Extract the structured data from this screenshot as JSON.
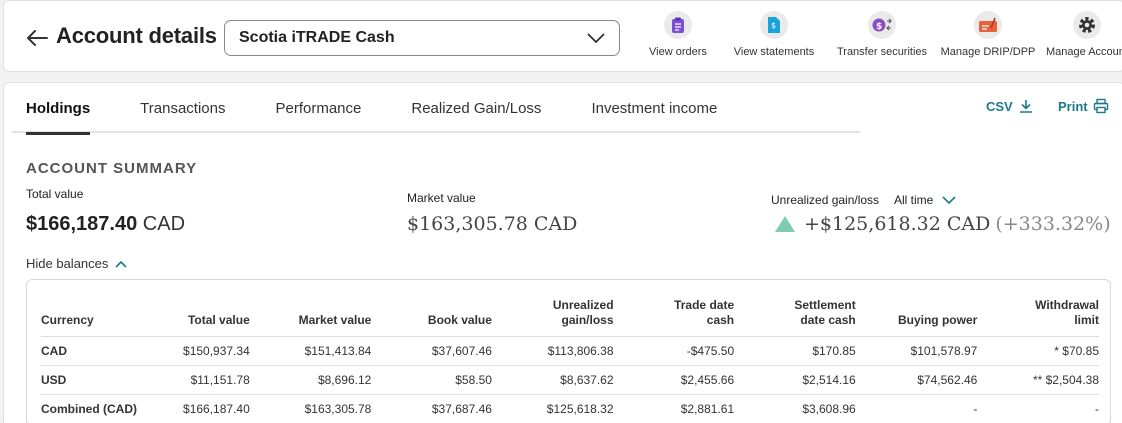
{
  "header": {
    "title": "Account details",
    "account_selected": "Scotia iTRADE Cash",
    "actions": [
      {
        "label": "View orders",
        "icon": "clipboard-icon",
        "color": "#7b4fd6"
      },
      {
        "label": "View statements",
        "icon": "statement-icon",
        "color": "#1aa3d9"
      },
      {
        "label": "Transfer securities",
        "icon": "transfer-icon",
        "color": "#8a4fc4"
      },
      {
        "label": "Manage DRIP/DPP",
        "icon": "cheque-icon",
        "color": "#e8603c"
      },
      {
        "label": "Manage Account",
        "icon": "gear-icon",
        "color": "#333333"
      }
    ]
  },
  "tabs": [
    {
      "label": "Holdings",
      "active": true
    },
    {
      "label": "Transactions",
      "active": false
    },
    {
      "label": "Performance",
      "active": false
    },
    {
      "label": "Realized Gain/Loss",
      "active": false
    },
    {
      "label": "Investment income",
      "active": false
    }
  ],
  "export": {
    "csv": "CSV",
    "print": "Print"
  },
  "summary": {
    "heading": "ACCOUNT SUMMARY",
    "total_label": "Total value",
    "total_amount": "$166,187.40",
    "total_currency": "CAD",
    "market_label": "Market value",
    "market_value": "$163,305.78 CAD",
    "gain_label": "Unrealized gain/loss",
    "gain_period": "All time",
    "gain_value": "+$125,618.32 CAD",
    "gain_pct": "(+333.32%)",
    "hide_balances": "Hide balances"
  },
  "colors": {
    "accent": "#1a7a8c",
    "gain_up": "#7ecbb3"
  },
  "table": {
    "headers": [
      "Currency",
      "Total value",
      "Market value",
      "Book value",
      "Unrealized gain/loss",
      "Trade date cash",
      "Settlement date cash",
      "Buying power",
      "Withdrawal limit"
    ],
    "rows": [
      [
        "CAD",
        "$150,937.34",
        "$151,413.84",
        "$37,607.46",
        "$113,806.38",
        "-$475.50",
        "$170.85",
        "$101,578.97",
        "* $70.85"
      ],
      [
        "USD",
        "$11,151.78",
        "$8,696.12",
        "$58.50",
        "$8,637.62",
        "$2,455.66",
        "$2,514.16",
        "$74,562.46",
        "** $2,504.38"
      ],
      [
        "Combined (CAD)",
        "$166,187.40",
        "$163,305.78",
        "$37,687.46",
        "$125,618.32",
        "$2,881.61",
        "$3,608.96",
        "-",
        "-"
      ]
    ]
  }
}
